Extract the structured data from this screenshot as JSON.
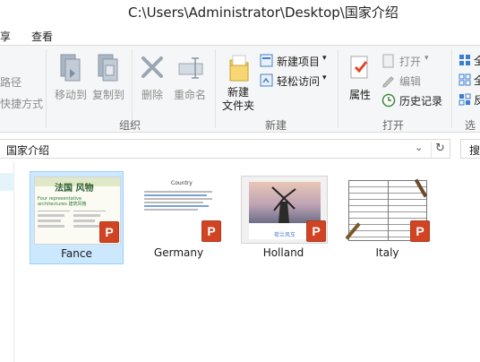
{
  "window": {
    "title": "C:\\Users\\Administrator\\Desktop\\国家介绍"
  },
  "tabs": {
    "home_partial": "享",
    "view": "查看"
  },
  "ribbon": {
    "left_partial_1": "路径",
    "left_partial_2": "快捷方式",
    "move_to": "移动到",
    "copy_to": "复制到",
    "delete": "删除",
    "rename": "重命名",
    "group_organize": "组织",
    "new_folder_line1": "新建",
    "new_folder_line2": "文件夹",
    "new_item": "新建项目",
    "easy_access": "轻松访问",
    "group_new": "新建",
    "properties": "属性",
    "open": "打开",
    "edit": "编辑",
    "history": "历史记录",
    "group_open": "打开",
    "right_partial_1": "全",
    "right_partial_2": "全",
    "right_partial_3": "反",
    "right_partial_4": "选"
  },
  "address": {
    "path": "国家介绍",
    "search_partial": "搜"
  },
  "files": [
    {
      "name": "Fance",
      "selected": true
    },
    {
      "name": "Germany",
      "selected": false
    },
    {
      "name": "Holland",
      "selected": false
    },
    {
      "name": "Italy",
      "selected": false
    }
  ],
  "thumbs": {
    "fance_heading": "法国 风物",
    "fance_sub": "Four representative architectures 建筑风格",
    "germany_heading": "Country",
    "holland_caption": "荷兰风车",
    "ppt_letter": "P"
  }
}
